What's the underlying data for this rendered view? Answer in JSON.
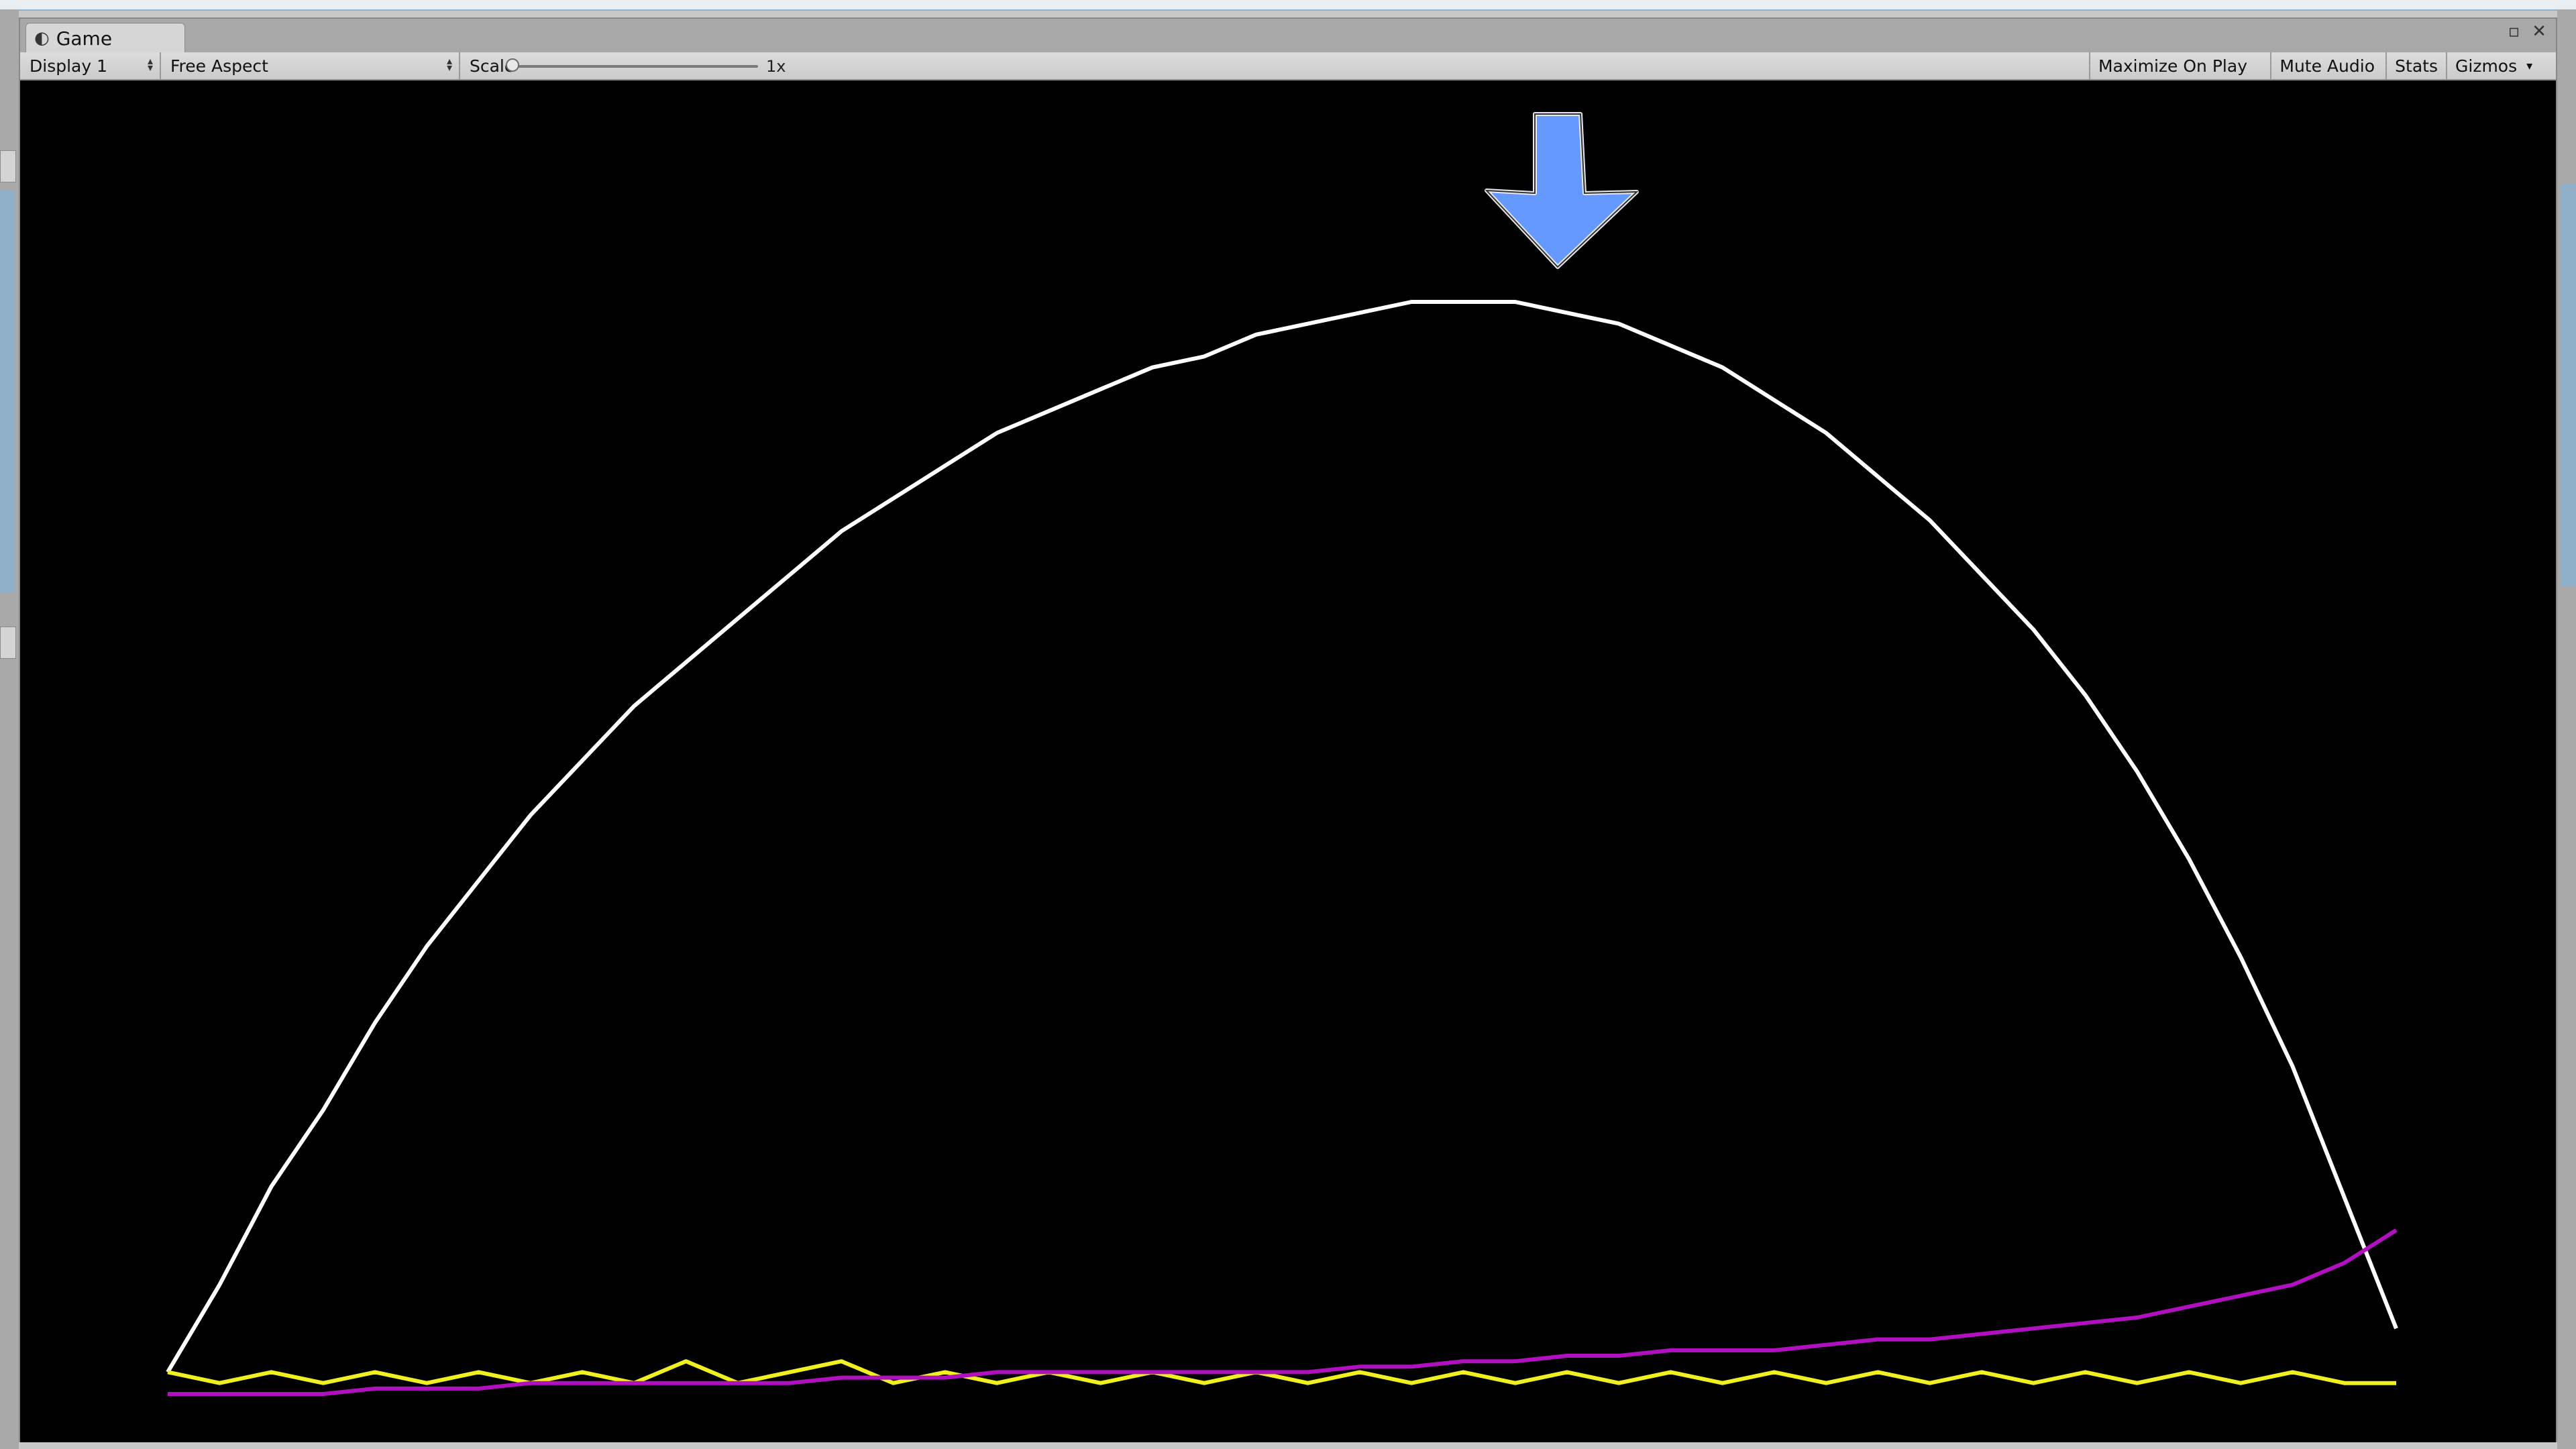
{
  "window": {
    "tab_label": "Game",
    "tab_icon": "game-controller-icon"
  },
  "toolbar": {
    "display": "Display 1",
    "aspect": "Free Aspect",
    "scale_label": "Scale",
    "scale_value": "1x",
    "maximize": "Maximize On Play",
    "mute": "Mute Audio",
    "stats": "Stats",
    "gizmos": "Gizmos"
  },
  "colors": {
    "viewport_bg": "#000000",
    "arrow_fill": "#6699ff",
    "series_white": "#ffffff",
    "series_yellow": "#f0f020",
    "series_magenta": "#b010c0"
  },
  "chart_data": {
    "type": "line",
    "grid": false,
    "series": [
      {
        "color": "#ffffff",
        "values": [
          0.02,
          0.1,
          0.19,
          0.26,
          0.34,
          0.41,
          0.47,
          0.53,
          0.58,
          0.63,
          0.67,
          0.71,
          0.75,
          0.79,
          0.82,
          0.85,
          0.88,
          0.9,
          0.92,
          0.94,
          0.95,
          0.97,
          0.98,
          0.99,
          1.0,
          1.0,
          1.0,
          0.99,
          0.98,
          0.96,
          0.94,
          0.91,
          0.88,
          0.84,
          0.8,
          0.75,
          0.7,
          0.64,
          0.57,
          0.49,
          0.4,
          0.3,
          0.18,
          0.06
        ]
      },
      {
        "color": "#f0f020",
        "values": [
          0.02,
          0.01,
          0.02,
          0.01,
          0.02,
          0.01,
          0.02,
          0.01,
          0.02,
          0.01,
          0.03,
          0.01,
          0.02,
          0.03,
          0.01,
          0.02,
          0.01,
          0.02,
          0.01,
          0.02,
          0.01,
          0.02,
          0.01,
          0.02,
          0.01,
          0.02,
          0.01,
          0.02,
          0.01,
          0.02,
          0.01,
          0.02,
          0.01,
          0.02,
          0.01,
          0.02,
          0.01,
          0.02,
          0.01,
          0.02,
          0.01,
          0.02,
          0.01,
          0.01
        ]
      },
      {
        "color": "#b010c0",
        "values": [
          0.0,
          0.0,
          0.0,
          0.0,
          0.005,
          0.005,
          0.005,
          0.01,
          0.01,
          0.01,
          0.01,
          0.01,
          0.01,
          0.015,
          0.015,
          0.015,
          0.02,
          0.02,
          0.02,
          0.02,
          0.02,
          0.02,
          0.02,
          0.025,
          0.025,
          0.03,
          0.03,
          0.035,
          0.035,
          0.04,
          0.04,
          0.04,
          0.045,
          0.05,
          0.05,
          0.055,
          0.06,
          0.065,
          0.07,
          0.08,
          0.09,
          0.1,
          0.12,
          0.15
        ]
      }
    ],
    "indicator": "down-arrow-icon"
  }
}
